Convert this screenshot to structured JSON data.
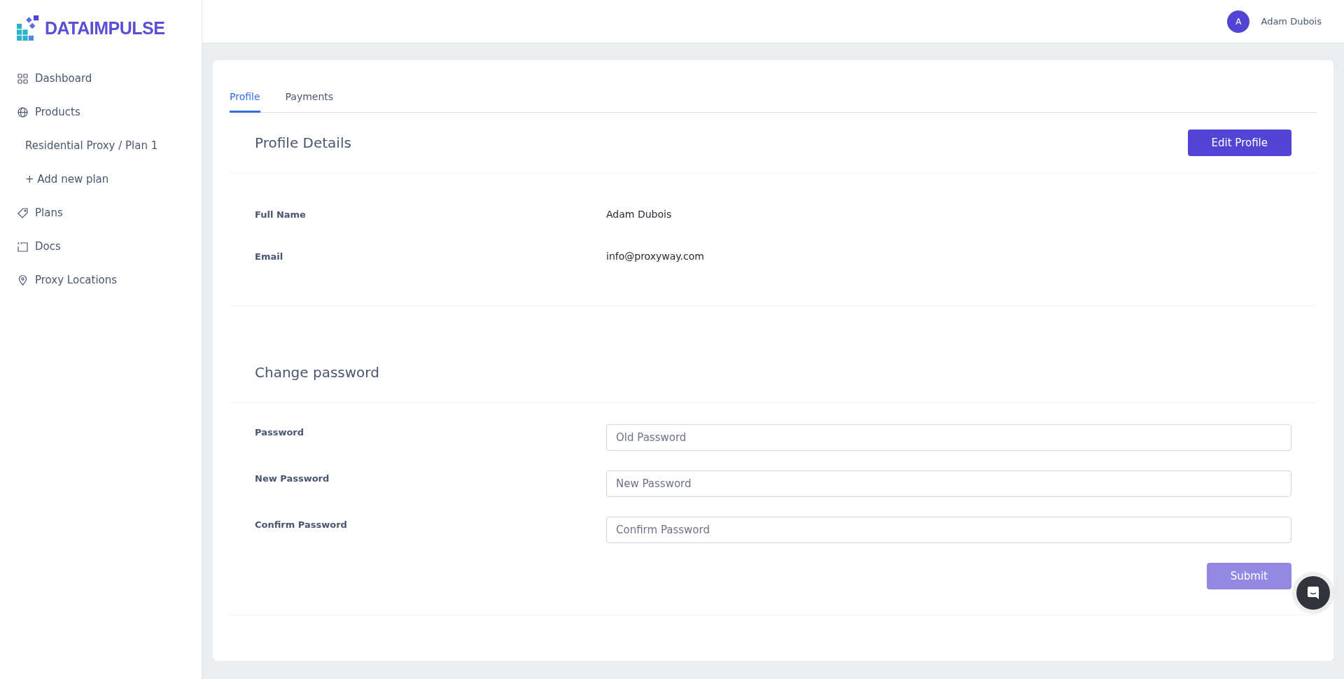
{
  "brand": {
    "name": "DATAIMPULSE"
  },
  "sidebar": {
    "items": [
      {
        "kind": "icon",
        "label": "Dashboard"
      },
      {
        "kind": "icon",
        "label": "Products"
      },
      {
        "kind": "sub",
        "label": "Residential Proxy / Plan 1"
      },
      {
        "kind": "sub",
        "label": "+ Add new plan"
      },
      {
        "kind": "icon",
        "label": "Plans"
      },
      {
        "kind": "icon",
        "label": "Docs"
      },
      {
        "kind": "icon",
        "label": "Proxy Locations"
      }
    ]
  },
  "header": {
    "avatar_initial": "A",
    "user_name": "Adam Dubois"
  },
  "tabs": [
    {
      "label": "Profile",
      "selected": true
    },
    {
      "label": "Payments",
      "selected": false
    }
  ],
  "profile_details": {
    "title": "Profile Details",
    "edit_button": "Edit Profile",
    "fields": [
      {
        "label": "Full Name",
        "value": "Adam Dubois"
      },
      {
        "label": "Email",
        "value": "info@proxyway.com"
      }
    ]
  },
  "change_password": {
    "title": "Change password",
    "fields": [
      {
        "label": "Password",
        "placeholder": "Old Password"
      },
      {
        "label": "New Password",
        "placeholder": "New Password"
      },
      {
        "label": "Confirm Password",
        "placeholder": "Confirm Password"
      }
    ],
    "submit": {
      "label": "Submit",
      "disabled": true
    }
  }
}
